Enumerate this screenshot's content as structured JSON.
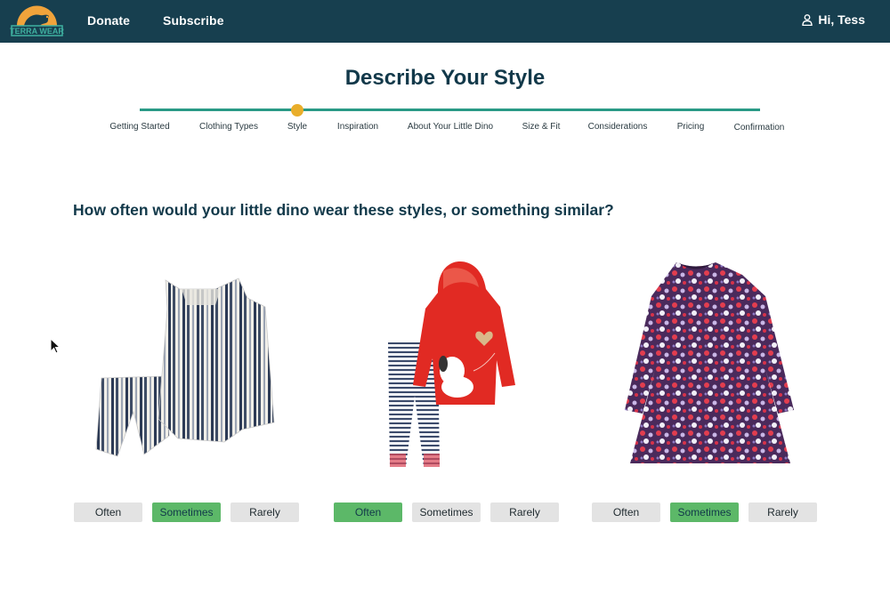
{
  "header": {
    "logo_text": "TERRA WEAR",
    "nav": [
      {
        "label": "Donate"
      },
      {
        "label": "Subscribe"
      }
    ],
    "user_greeting": "Hi, Tess",
    "user_icon": "person-icon"
  },
  "page": {
    "title": "Describe Your Style",
    "question": "How often would your little dino wear these styles, or something similar?"
  },
  "stepper": {
    "current_step": "Style",
    "steps": [
      {
        "label": "Getting Started"
      },
      {
        "label": "Clothing Types"
      },
      {
        "label": "Style"
      },
      {
        "label": "Inspiration"
      },
      {
        "label": "About Your Little Dino"
      },
      {
        "label": "Size & Fit"
      },
      {
        "label": "Considerations"
      },
      {
        "label": "Pricing"
      },
      {
        "label": "Confirmation"
      }
    ]
  },
  "products": [
    {
      "image": "striped-top-and-shorts-set",
      "options": [
        "Often",
        "Sometimes",
        "Rarely"
      ],
      "selected": "Sometimes"
    },
    {
      "image": "red-hoodie-and-striped-leggings",
      "options": [
        "Often",
        "Sometimes",
        "Rarely"
      ],
      "selected": "Often"
    },
    {
      "image": "floral-dress",
      "options": [
        "Often",
        "Sometimes",
        "Rarely"
      ],
      "selected": "Sometimes"
    }
  ],
  "colors": {
    "header_bg": "#173f4f",
    "title_text": "#12394a",
    "progress_track": "#2a9a86",
    "progress_marker": "#e9ae2b",
    "selected_button": "#5cb868",
    "unselected_button": "#e3e3e3"
  }
}
